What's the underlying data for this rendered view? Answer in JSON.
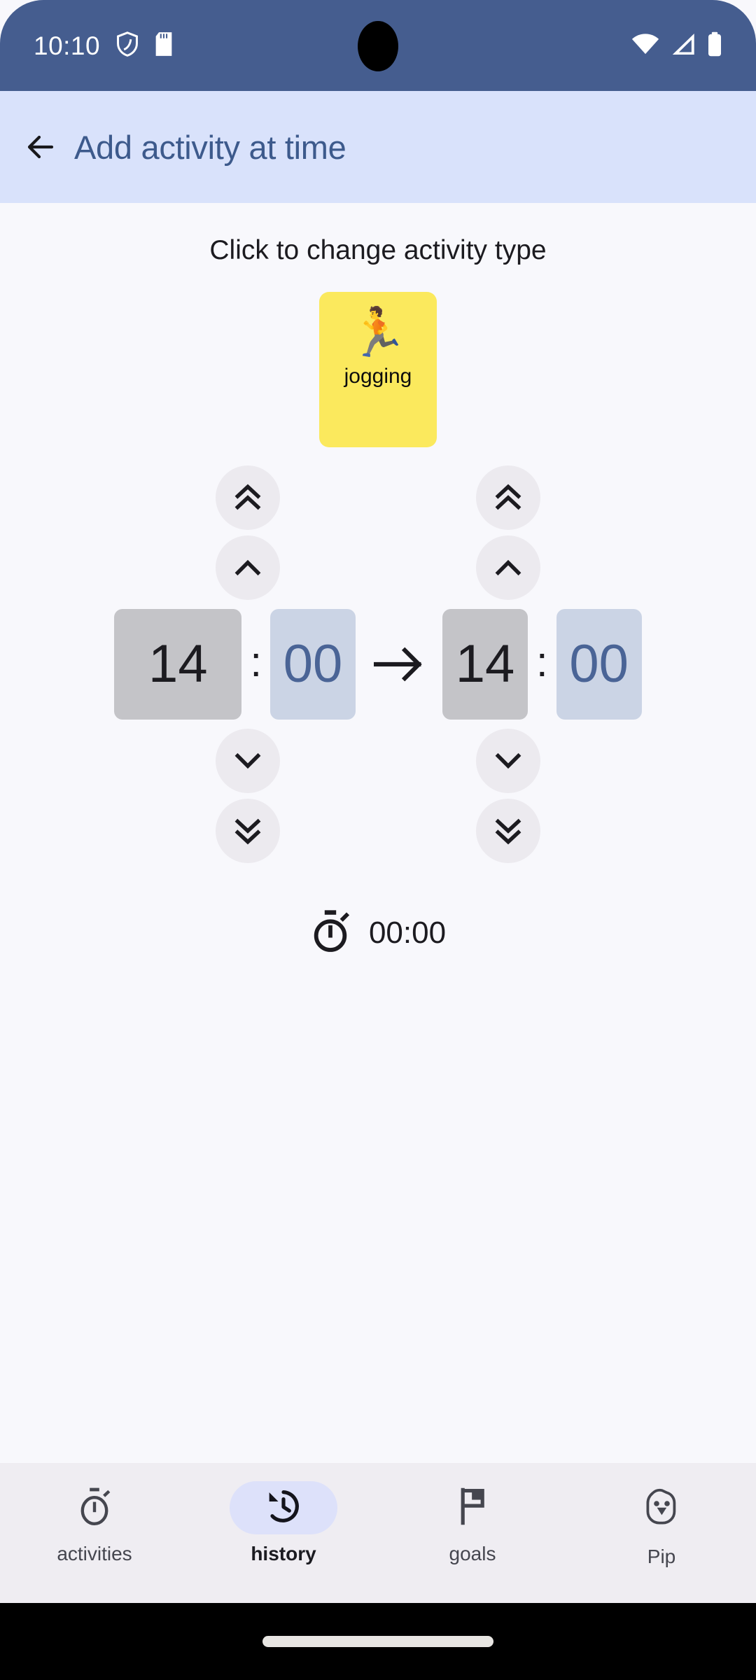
{
  "status_bar": {
    "clock": "10:10",
    "icons": [
      "shield-icon",
      "sd-card-icon",
      "wifi-icon",
      "cellular-signal-icon",
      "battery-icon"
    ],
    "background_color": "#455d8f"
  },
  "app_bar": {
    "back_label": "back-arrow",
    "title": "Add activity at time",
    "background_color": "#d9e2fb",
    "title_color": "#3d5a8c"
  },
  "main": {
    "hint": "Click to change activity type",
    "activity": {
      "emoji": "🏃",
      "label": "jogging",
      "card_color": "#fbe95d"
    },
    "time_picker": {
      "start": {
        "hour": "14",
        "minute": "00"
      },
      "end": {
        "hour": "14",
        "minute": "00"
      },
      "separator": ":",
      "range_arrow": "→",
      "hour_box_color": "#c4c4c8",
      "minute_box_color": "#cbd4e5",
      "minute_text_color": "#4a6496",
      "buttons": {
        "up_fast": "double-chevron-up",
        "up": "chevron-up",
        "down": "chevron-down",
        "down_fast": "double-chevron-down"
      }
    },
    "duration": {
      "icon": "stopwatch-icon",
      "value": "00:00"
    }
  },
  "bottom_nav": {
    "background_color": "#efedf2",
    "active_pill_color": "#dde1fa",
    "items": [
      {
        "label": "activities",
        "icon": "stopwatch-icon",
        "active": false
      },
      {
        "label": "history",
        "icon": "history-clock-icon",
        "active": true
      },
      {
        "label": "goals",
        "icon": "flag-icon",
        "active": false
      },
      {
        "label": "Pip",
        "icon": "bird-face-icon",
        "active": false
      }
    ]
  }
}
